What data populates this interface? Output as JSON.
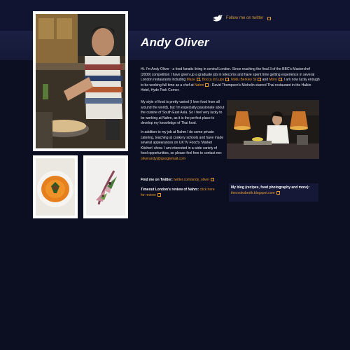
{
  "header": {
    "twitter_link": "Follow me on twitter"
  },
  "page": {
    "title": "Andy Oliver"
  },
  "intro": {
    "p1": "Hi. I'm Andy Oliver - a food fanatic living in central London. Since reaching the final 3 of the BBC's Masterchef (2009) competition I have given up a graduate job in telecoms and have spent time getting experience in several London restaurants including ",
    "link_maze": "Maze",
    "sep1": ", ",
    "link_bocca": "Bocca di Lupo",
    "sep2": ", ",
    "link_nobu": "Nobu Berkley St",
    "sep3": " and ",
    "link_moro": "Moro",
    "p1b": ". I am now lucky enough to be working full time as a chef at ",
    "link_nahm": "Nahm",
    "p1c": " - David Thompson's Michelin starred Thai restaurant in the Halkin Hotel, Hyde Park Corner."
  },
  "style_para": "My style of food is pretty varied (I love food from all around the world), but I'm especially passionate about the cuisine of South East Asia. So I feel very lucky to be working at Nahm, as it is the perfect place to develop my knowledge of Thai food.",
  "work_para": {
    "text": "In addition to my job at Nahm I do some private catering, teaching at cookery schools and have made several appearances on UKTV Food's 'Market Kitchen' show. I am interested in a wide variety of food opportunities, so please feel free to contact me: ",
    "email": "oliverandyj@googlemail.com"
  },
  "find_twitter": {
    "label": "Find me on Twitter:",
    "link": "twitter.com/andy_oliver"
  },
  "timeout": {
    "label": "Timeout London's review of Nahm:",
    "link1": "click here",
    "link2": "for review"
  },
  "blog": {
    "label": "My blog (recipes, food photography and more):",
    "link": "thecooksbroth.blogspot.com"
  },
  "colors": {
    "background": "#0c0f22",
    "accent": "#e69a2e",
    "frame": "#ffffff"
  },
  "icons": {
    "twitter": "bird-icon",
    "external": "external-link-icon"
  }
}
